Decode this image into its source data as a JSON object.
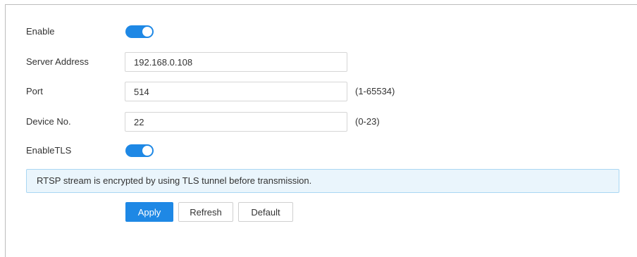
{
  "form": {
    "enable": {
      "label": "Enable",
      "on": true
    },
    "server_address": {
      "label": "Server Address",
      "value": "192.168.0.108"
    },
    "port": {
      "label": "Port",
      "value": "514",
      "range": "(1-65534)"
    },
    "device_no": {
      "label": "Device No.",
      "value": "22",
      "range": "(0-23)"
    },
    "enable_tls": {
      "label": "EnableTLS",
      "on": true
    }
  },
  "notice": "RTSP stream is encrypted by using TLS tunnel before transmission.",
  "buttons": {
    "apply": "Apply",
    "refresh": "Refresh",
    "default": "Default"
  },
  "colors": {
    "accent": "#1e88e5",
    "notice_bg": "#eaf5fc",
    "notice_border": "#a9d7f3"
  }
}
